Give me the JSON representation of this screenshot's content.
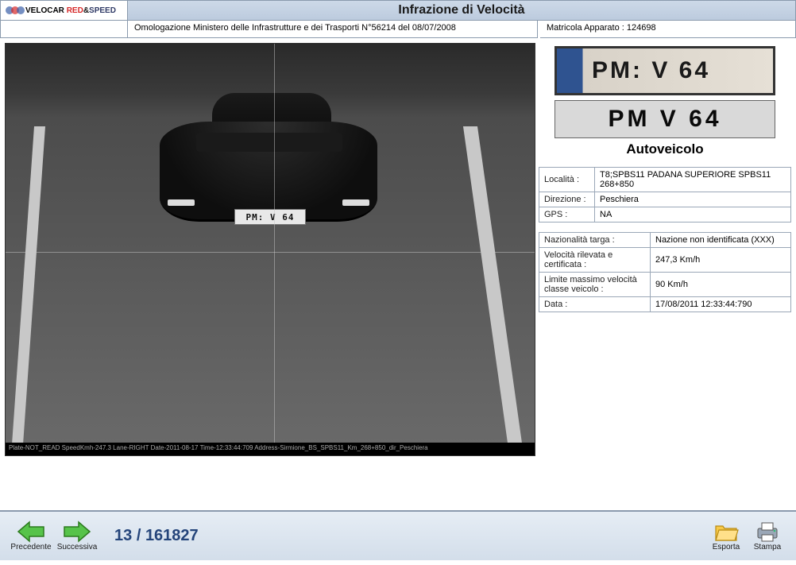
{
  "header": {
    "logo_text_velocar": "VELOCAR",
    "logo_text_red": "RED",
    "logo_text_amp": "&",
    "logo_text_speed": "SPEED",
    "title": "Infrazione di Velocità",
    "omologazione": "Omologazione Ministero delle Infrastrutture e dei Trasporti N°56214 del 08/07/2008",
    "matricola_label": "Matricola Apparato :",
    "matricola_value": "124698"
  },
  "photo": {
    "plate_on_car": "PM: V 64",
    "caption": "Plate-NOT_READ SpeedKmh-247.3 Lane-RIGHT Date-2011-08-17 Time-12:33:44:709 Address-Sirmione_BS_SPBS11_Km_268+850_dir_Peschiera"
  },
  "plate": {
    "crop_text": "PM:  V  64",
    "ocr_text": "PM  V  64",
    "vehicle_type": "Autoveicolo"
  },
  "location": {
    "localita_label": "Località :",
    "localita_value": "T8;SPBS11 PADANA SUPERIORE SPBS11 268+850",
    "direzione_label": "Direzione :",
    "direzione_value": "Peschiera",
    "gps_label": "GPS :",
    "gps_value": "NA"
  },
  "speed": {
    "nazionalita_label": "Nazionalità targa :",
    "nazionalita_value": "Nazione non identificata (XXX)",
    "velocita_label": "Velocità rilevata e certificata :",
    "velocita_value": "247,3 Km/h",
    "limite_label": "Limite massimo velocità classe veicolo :",
    "limite_value": "90 Km/h",
    "data_label": "Data :",
    "data_value": "17/08/2011 12:33:44:790"
  },
  "footer": {
    "precedente": "Precedente",
    "successiva": "Successiva",
    "page_current": "13",
    "page_total": "161827",
    "esporta": "Esporta",
    "stampa": "Stampa"
  }
}
